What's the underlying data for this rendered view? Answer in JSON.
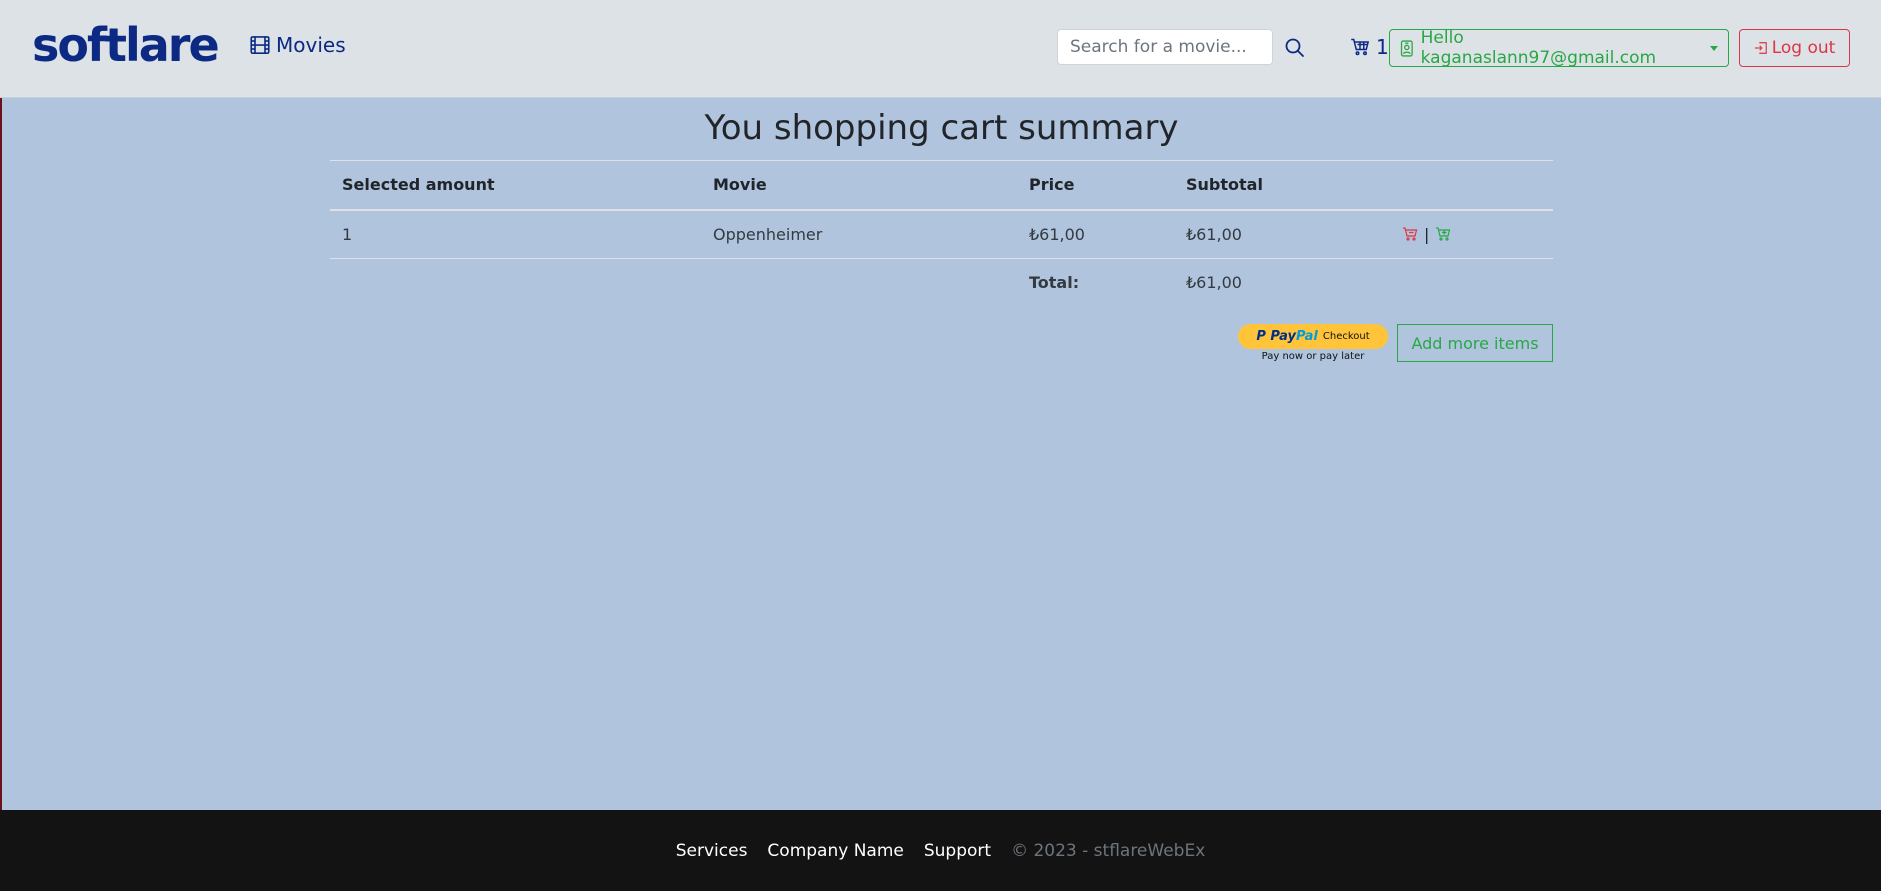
{
  "navbar": {
    "brand": "softlare",
    "movies_label": "Movies",
    "search_placeholder": "Search for a movie...",
    "cart_count": "1",
    "user_label": "Hello kaganaslann97@gmail.com",
    "logout_label": "Log out",
    "icons": {
      "movies": "film-icon",
      "search": "search-icon",
      "cart": "cart-icon",
      "user": "person-badge-icon",
      "logout": "box-arrow-in-right-icon"
    }
  },
  "content": {
    "title": "You shopping cart summary",
    "headers": [
      "Selected amount",
      "Movie",
      "Price",
      "Subtotal",
      ""
    ],
    "rows": [
      {
        "amount": "1",
        "movie": "Oppenheimer",
        "price": "₺61,00",
        "subtotal": "₺61,00",
        "separator": "|"
      }
    ],
    "total_label": "Total:",
    "total_value": "₺61,00",
    "paypal": {
      "brand_pay": "Pay",
      "brand_pal": "Pal",
      "checkout": "Checkout",
      "subtext": "Pay now or pay later"
    },
    "add_more_label": "Add more items"
  },
  "footer": {
    "links": [
      "Services",
      "Company Name",
      "Support"
    ],
    "copyright": "© 2023 - stflareWebEx"
  },
  "colors": {
    "page_bg": "#b0c4de",
    "navbar_bg": "#dde2e7",
    "brand": "#0c2a84",
    "success": "#28a745",
    "danger": "#dc3545",
    "footer_bg": "#131313",
    "paypal_yellow": "#ffc439"
  }
}
